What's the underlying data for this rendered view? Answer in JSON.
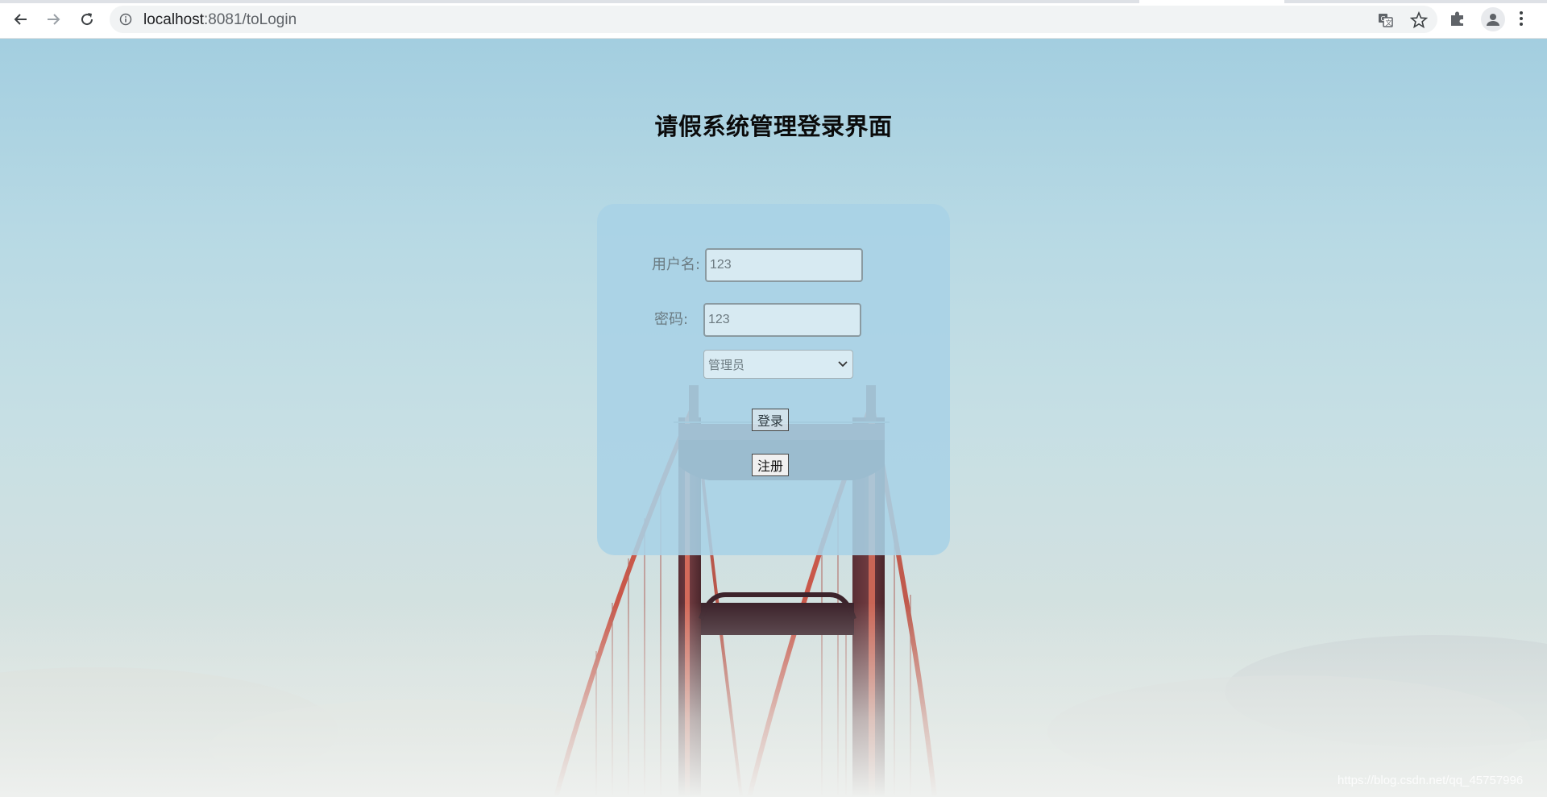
{
  "browser": {
    "url_host": "localhost",
    "url_path": ":8081/toLogin"
  },
  "page": {
    "title": "请假系统管理登录界面"
  },
  "login_form": {
    "username_label": "用户名:",
    "username_value": "123",
    "password_label": "密码:",
    "password_value": "123",
    "role_selected": "管理员",
    "login_button": "登录",
    "register_button": "注册"
  },
  "watermark": "https://blog.csdn.net/qq_45757996"
}
